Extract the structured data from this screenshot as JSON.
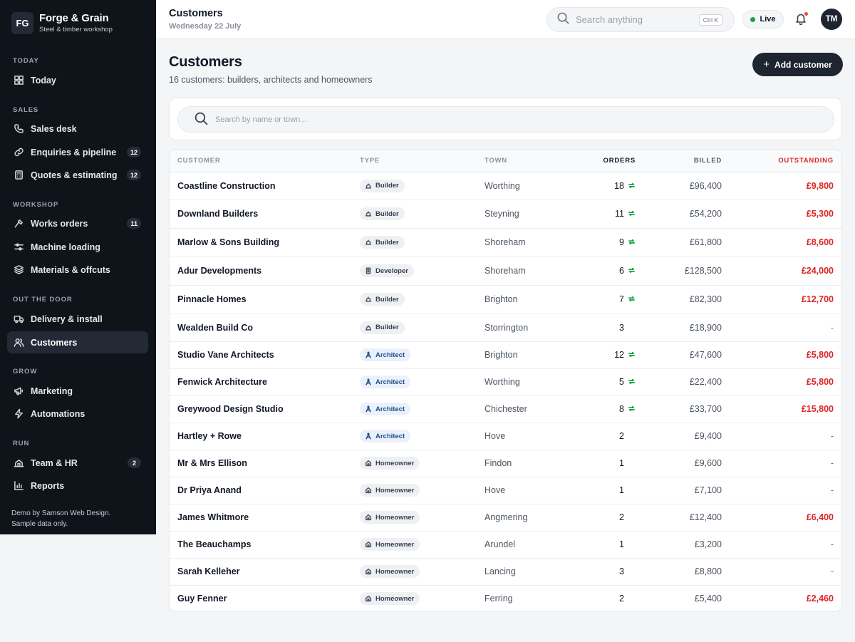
{
  "brand": {
    "logo": "FG",
    "name": "Forge & Grain",
    "subtitle": "Steel & timber workshop"
  },
  "sidebar": {
    "sections": [
      {
        "label": "TODAY",
        "items": [
          {
            "label": "Today",
            "icon": "grid-icon"
          }
        ]
      },
      {
        "label": "SALES",
        "items": [
          {
            "label": "Sales desk",
            "icon": "phone-icon"
          },
          {
            "label": "Enquiries & pipeline",
            "icon": "link-icon",
            "badge": "12"
          },
          {
            "label": "Quotes & estimating",
            "icon": "calculator-icon",
            "badge": "12"
          }
        ]
      },
      {
        "label": "WORKSHOP",
        "items": [
          {
            "label": "Works orders",
            "icon": "hammer-icon",
            "badge": "11"
          },
          {
            "label": "Machine loading",
            "icon": "sliders-icon"
          },
          {
            "label": "Materials & offcuts",
            "icon": "layers-icon"
          }
        ]
      },
      {
        "label": "OUT THE DOOR",
        "items": [
          {
            "label": "Delivery & install",
            "icon": "truck-icon"
          },
          {
            "label": "Customers",
            "icon": "users-icon",
            "active": true
          }
        ]
      },
      {
        "label": "GROW",
        "items": [
          {
            "label": "Marketing",
            "icon": "megaphone-icon"
          },
          {
            "label": "Automations",
            "icon": "lightning-icon"
          }
        ]
      },
      {
        "label": "RUN",
        "items": [
          {
            "label": "Team & HR",
            "icon": "team-icon",
            "badge": "2"
          },
          {
            "label": "Reports",
            "icon": "bar-chart-icon"
          }
        ]
      }
    ],
    "footer_line1": "Demo by Samson Web Design.",
    "footer_line2": "Sample data only."
  },
  "topbar": {
    "title": "Customers",
    "date": "Wednesday 22 July",
    "search_placeholder": "Search anything",
    "search_shortcut": "Ctrl K",
    "live_label": "Live",
    "avatar_initials": "TM"
  },
  "main": {
    "title": "Customers",
    "subtitle": "16 customers: builders, architects and homeowners",
    "add_button": "Add customer",
    "filter_placeholder": "Search by name or town..."
  },
  "table": {
    "columns": {
      "customer": "CUSTOMER",
      "type": "TYPE",
      "town": "TOWN",
      "orders": "ORDERS",
      "billed": "BILLED",
      "outstanding": "OUTSTANDING"
    },
    "rows": [
      {
        "name": "Coastline Construction",
        "type": "Builder",
        "town": "Worthing",
        "orders": "18",
        "repeat": true,
        "billed": "£96,400",
        "outstanding": "£9,800"
      },
      {
        "name": "Downland Builders",
        "type": "Builder",
        "town": "Steyning",
        "orders": "11",
        "repeat": true,
        "billed": "£54,200",
        "outstanding": "£5,300"
      },
      {
        "name": "Marlow & Sons Building",
        "type": "Builder",
        "town": "Shoreham",
        "orders": "9",
        "repeat": true,
        "billed": "£61,800",
        "outstanding": "£8,600"
      },
      {
        "name": "Adur Developments",
        "type": "Developer",
        "town": "Shoreham",
        "orders": "6",
        "repeat": true,
        "billed": "£128,500",
        "outstanding": "£24,000"
      },
      {
        "name": "Pinnacle Homes",
        "type": "Builder",
        "town": "Brighton",
        "orders": "7",
        "repeat": true,
        "billed": "£82,300",
        "outstanding": "£12,700"
      },
      {
        "name": "Wealden Build Co",
        "type": "Builder",
        "town": "Storrington",
        "orders": "3",
        "repeat": false,
        "billed": "£18,900",
        "outstanding": "-"
      },
      {
        "name": "Studio Vane Architects",
        "type": "Architect",
        "town": "Brighton",
        "orders": "12",
        "repeat": true,
        "billed": "£47,600",
        "outstanding": "£5,800"
      },
      {
        "name": "Fenwick Architecture",
        "type": "Architect",
        "town": "Worthing",
        "orders": "5",
        "repeat": true,
        "billed": "£22,400",
        "outstanding": "£5,800"
      },
      {
        "name": "Greywood Design Studio",
        "type": "Architect",
        "town": "Chichester",
        "orders": "8",
        "repeat": true,
        "billed": "£33,700",
        "outstanding": "£15,800"
      },
      {
        "name": "Hartley + Rowe",
        "type": "Architect",
        "town": "Hove",
        "orders": "2",
        "repeat": false,
        "billed": "£9,400",
        "outstanding": "-"
      },
      {
        "name": "Mr & Mrs Ellison",
        "type": "Homeowner",
        "town": "Findon",
        "orders": "1",
        "repeat": false,
        "billed": "£9,600",
        "outstanding": "-"
      },
      {
        "name": "Dr Priya Anand",
        "type": "Homeowner",
        "town": "Hove",
        "orders": "1",
        "repeat": false,
        "billed": "£7,100",
        "outstanding": "-"
      },
      {
        "name": "James Whitmore",
        "type": "Homeowner",
        "town": "Angmering",
        "orders": "2",
        "repeat": false,
        "billed": "£12,400",
        "outstanding": "£6,400"
      },
      {
        "name": "The Beauchamps",
        "type": "Homeowner",
        "town": "Arundel",
        "orders": "1",
        "repeat": false,
        "billed": "£3,200",
        "outstanding": "-"
      },
      {
        "name": "Sarah Kelleher",
        "type": "Homeowner",
        "town": "Lancing",
        "orders": "3",
        "repeat": false,
        "billed": "£8,800",
        "outstanding": "-"
      },
      {
        "name": "Guy Fenner",
        "type": "Homeowner",
        "town": "Ferring",
        "orders": "2",
        "repeat": false,
        "billed": "£5,400",
        "outstanding": "£2,460"
      }
    ]
  },
  "colors": {
    "sidebar_bg": "#0f141b",
    "accent_dark": "#1f2530",
    "outstanding_red": "#dc2626",
    "live_green": "#16a34a",
    "architect_blue": "#1e4f8c"
  }
}
